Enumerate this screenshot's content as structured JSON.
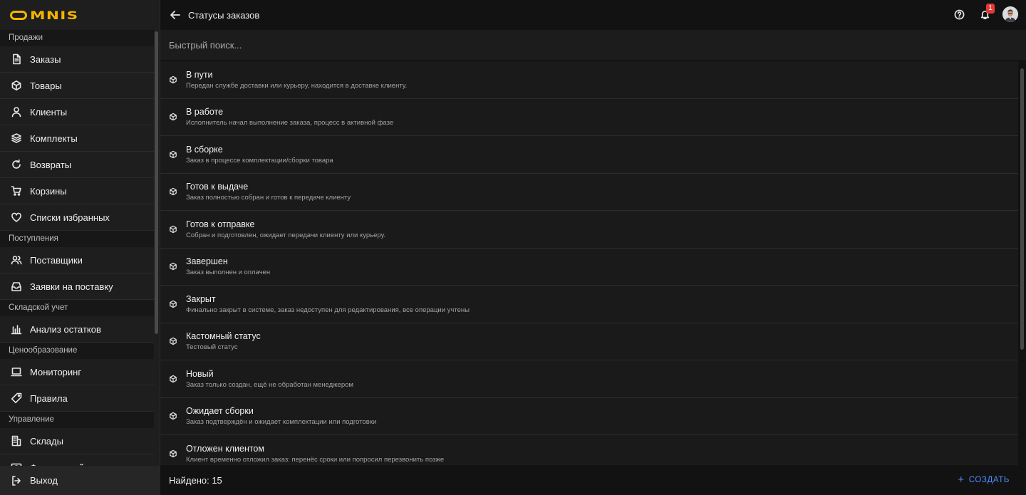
{
  "app": {
    "logo_text": "MNIS",
    "brand_color": "#f4b400",
    "accent_color": "#4d8cff"
  },
  "header": {
    "title": "Статусы заказов",
    "notifications_count": "1"
  },
  "search": {
    "placeholder": "Быстрый поиск..."
  },
  "sidebar": {
    "sections": [
      {
        "title": "Продажи",
        "items": [
          {
            "label": "Заказы",
            "icon": "document-icon"
          },
          {
            "label": "Товары",
            "icon": "box-icon"
          },
          {
            "label": "Клиенты",
            "icon": "user-icon"
          },
          {
            "label": "Комплекты",
            "icon": "layers-icon"
          },
          {
            "label": "Возвраты",
            "icon": "refresh-icon"
          },
          {
            "label": "Корзины",
            "icon": "cart-icon"
          },
          {
            "label": "Списки избранных",
            "icon": "heart-icon"
          }
        ]
      },
      {
        "title": "Поступления",
        "items": [
          {
            "label": "Поставщики",
            "icon": "users-icon"
          },
          {
            "label": "Заявки на поставку",
            "icon": "inbox-icon"
          }
        ]
      },
      {
        "title": "Складской учет",
        "items": [
          {
            "label": "Анализ остатков",
            "icon": "bar-chart-icon"
          }
        ]
      },
      {
        "title": "Ценообразование",
        "items": [
          {
            "label": "Мониторинг",
            "icon": "laptop-icon"
          },
          {
            "label": "Правила",
            "icon": "tag-icon"
          }
        ]
      },
      {
        "title": "Управление",
        "items": [
          {
            "label": "Склады",
            "icon": "building-icon"
          },
          {
            "label": "Финансовый учет",
            "icon": "finance-icon"
          }
        ]
      }
    ],
    "exit_label": "Выход"
  },
  "statuses": [
    {
      "name": "В пути",
      "description": "Передан службе доставки или курьеру, находится в доставке клиенту."
    },
    {
      "name": "В работе",
      "description": "Исполнитель начал выполнение заказа, процесс в активной фазе"
    },
    {
      "name": "В сборке",
      "description": "Заказ в процессе комплектации/сборки товара"
    },
    {
      "name": "Готов к выдаче",
      "description": "Заказ полностью собран и готов к передаче клиенту"
    },
    {
      "name": "Готов к отправке",
      "description": "Собран и подготовлен, ожидает передачи клиенту или курьеру."
    },
    {
      "name": "Завершен",
      "description": "Заказ выполнен и оплачен"
    },
    {
      "name": "Закрыт",
      "description": "Финально закрыт в системе, заказ недоступен для редактирования, все операции учтены"
    },
    {
      "name": "Кастомный статус",
      "description": "Тестовый статус"
    },
    {
      "name": "Новый",
      "description": "Заказ только создан, ещё не обработан менеджером"
    },
    {
      "name": "Ожидает сборки",
      "description": "Заказ подтверждён и ожидает комплектации или подготовки"
    },
    {
      "name": "Отложен клиентом",
      "description": "Клиент временно отложил заказ: перенёс сроки или попросил перезвонить позже"
    }
  ],
  "footer": {
    "found_label": "Найдено: 15",
    "create_label": "СОЗДАТЬ"
  }
}
